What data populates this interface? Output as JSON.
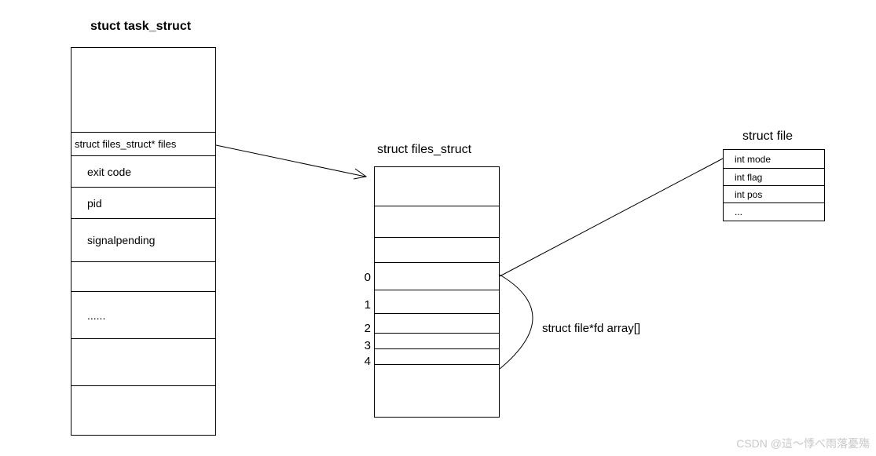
{
  "titles": {
    "task_struct": "stuct task_struct",
    "files_struct": "struct files_struct",
    "struct_file": "struct file"
  },
  "task_struct": {
    "rows": {
      "files": "struct files_struct* files",
      "exit_code": "exit code",
      "pid": "pid",
      "signalpending": "signalpending",
      "ellipsis": "......"
    }
  },
  "files_struct": {
    "indices": [
      "0",
      "1",
      "2",
      "3",
      "4"
    ]
  },
  "struct_file": {
    "rows": {
      "mode": "int mode",
      "flag": "int flag",
      "pos": "int pos",
      "more": "..."
    }
  },
  "annotations": {
    "fd_array": "struct file*fd array[]"
  },
  "watermark": "CSDN @這～悸べ雨落憂殤"
}
